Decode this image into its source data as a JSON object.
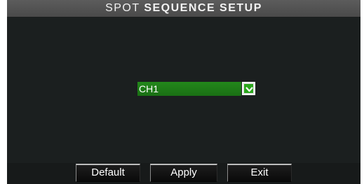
{
  "window": {
    "title_prefix": "SPOT",
    "title_main": "SEQUENCE SETUP"
  },
  "channel_select": {
    "value": "CH1",
    "color": "#1e7d17"
  },
  "buttons": {
    "default_label": "Default",
    "apply_label": "Apply",
    "exit_label": "Exit"
  },
  "icons": {
    "dropdown": "chevron-down-icon"
  }
}
